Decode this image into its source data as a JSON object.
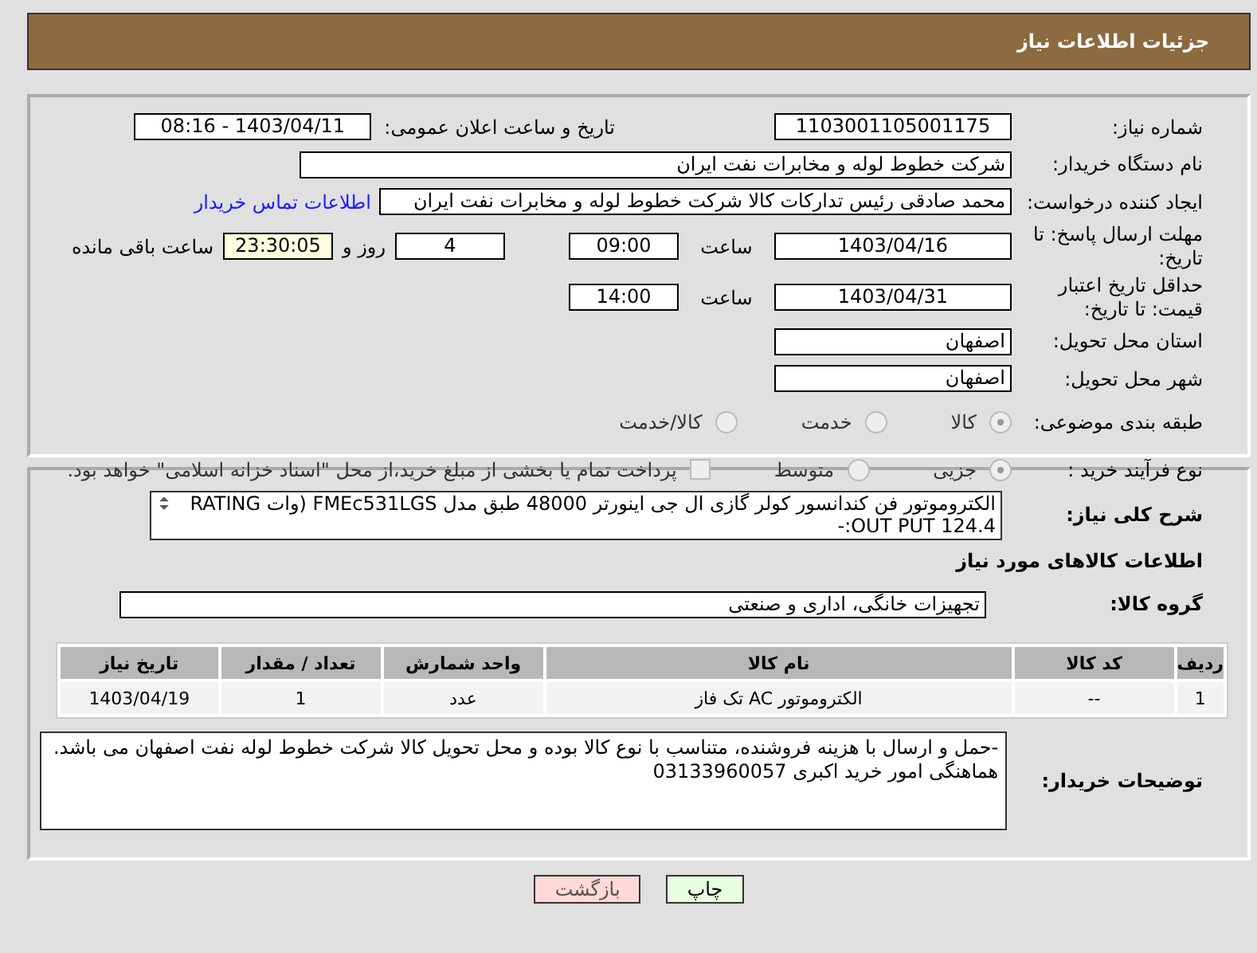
{
  "header": {
    "title": "جزئیات اطلاعات نیاز"
  },
  "need_number": {
    "label": "شماره نیاز:",
    "value": "1103001105001175"
  },
  "announce": {
    "label": "تاریخ و ساعت اعلان عمومی:",
    "value": "1403/04/11 - 08:16"
  },
  "buyer_org": {
    "label": "نام دستگاه خریدار:",
    "value": "شرکت خطوط لوله و مخابرات نفت ایران"
  },
  "creator": {
    "label": "ایجاد کننده درخواست:",
    "value": "محمد صادقی رئیس تدارکات کالا  شرکت خطوط لوله و مخابرات نفت ایران",
    "link": "اطلاعات تماس خریدار"
  },
  "deadline": {
    "label": "مهلت ارسال پاسخ: تا تاریخ:",
    "date": "1403/04/16",
    "time_label": "ساعت",
    "time": "09:00",
    "days": "4",
    "days_label": "روز و",
    "remaining": "23:30:05",
    "remaining_label": "ساعت باقی مانده"
  },
  "validity": {
    "label": "حداقل تاریخ اعتبار قیمت: تا تاریخ:",
    "date": "1403/04/31",
    "time_label": "ساعت",
    "time": "14:00"
  },
  "province": {
    "label": "استان محل تحویل:",
    "value": "اصفهان"
  },
  "city": {
    "label": "شهر محل تحویل:",
    "value": "اصفهان"
  },
  "category": {
    "label": "طبقه بندی موضوعی:",
    "options": [
      {
        "label": "کالا",
        "selected": true
      },
      {
        "label": "خدمت",
        "selected": false
      },
      {
        "label": "کالا/خدمت",
        "selected": false
      }
    ]
  },
  "process": {
    "label": "نوع فرآیند خرید :",
    "options": [
      {
        "label": "جزیی",
        "selected": true
      },
      {
        "label": "متوسط",
        "selected": false
      }
    ],
    "checkbox": {
      "checked": false,
      "label": "پرداخت تمام یا بخشی از مبلغ خرید،از محل \"اسناد خزانه اسلامی\" خواهد بود."
    }
  },
  "description": {
    "label": "شرح کلی نیاز:",
    "value": "الکتروموتور فن کندانسور کولر گازی ال جی اینورتر 48000 طبق مدل FMEc531LGS (وات RATING OUT PUT 124.4:-"
  },
  "items_heading": "اطلاعات کالاهای مورد نیاز",
  "group": {
    "label": "گروه کالا:",
    "value": "تجهیزات خانگی، اداری و صنعتی"
  },
  "table": {
    "columns": [
      "ردیف",
      "کد کالا",
      "نام کالا",
      "واحد شمارش",
      "تعداد / مقدار",
      "تاریخ نیاز"
    ],
    "rows": [
      [
        "1",
        "--",
        "الکتروموتور AC تک فاز",
        "عدد",
        "1",
        "1403/04/19"
      ]
    ]
  },
  "notes": {
    "label": "توضیحات خریدار:",
    "value": "-حمل و ارسال  با هزینه فروشنده، متناسب با نوع کالا بوده و محل تحویل کالا شرکت خطوط لوله نفت اصفهان  می باشد. هماهنگی امور خرید اکبری 03133960057"
  },
  "buttons": [
    {
      "label": "چاپ",
      "kind": "print"
    },
    {
      "label": "بازگشت",
      "kind": "back"
    }
  ]
}
